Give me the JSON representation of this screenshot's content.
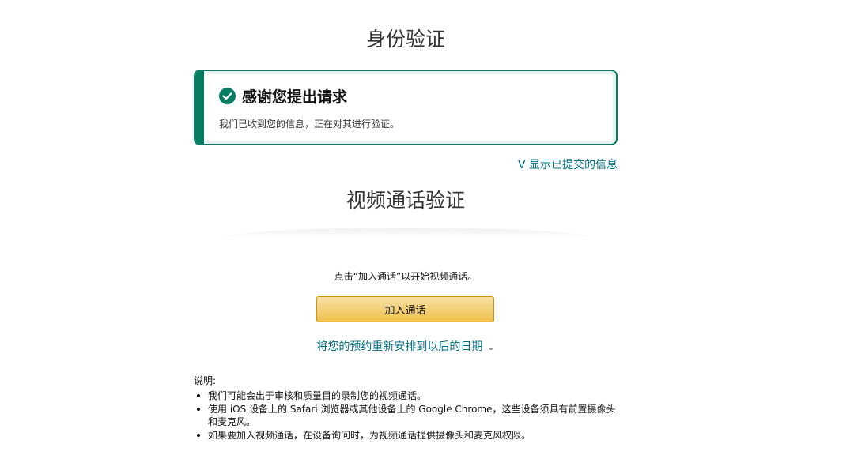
{
  "page_title": "身份验证",
  "alert": {
    "title": "感谢您提出请求",
    "message": "我们已收到您的信息，正在对其进行验证。"
  },
  "toggle_link": "V 显示已提交的信息",
  "section_title": "视频通话验证",
  "instruction": "点击“加入通话”以开始视频通话。",
  "join_button": "加入通话",
  "reschedule_link": "将您的预约重新安排到以后的日期",
  "notes": {
    "title": "说明:",
    "items": [
      "我们可能会出于审核和质量目的录制您的视频通话。",
      "使用 iOS 设备上的 Safari 浏览器或其他设备上的 Google Chrome，这些设备须具有前置摄像头和麦克风。",
      "如果要加入视频通话，在设备询问时，为视频通话提供摄像头和麦克风权限。"
    ]
  },
  "colors": {
    "success": "#067d62",
    "link": "#007185",
    "button": "#f0c14b"
  },
  "icons": [
    "check-circle-icon",
    "chevron-down-icon"
  ]
}
